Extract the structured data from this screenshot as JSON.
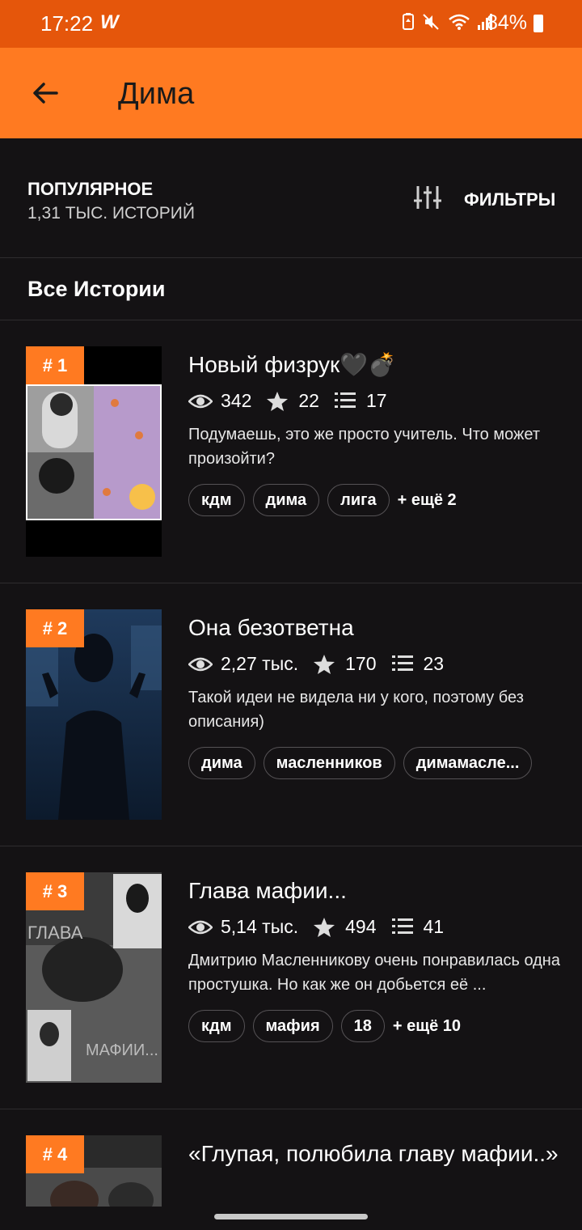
{
  "status_bar": {
    "time": "17:22",
    "app_logo": "W",
    "battery": "84%"
  },
  "app_bar": {
    "title": "Дима"
  },
  "filter_bar": {
    "sort_label": "ПОПУЛЯРНОЕ",
    "count_label": "1,31 ТЫС. ИСТОРИЙ",
    "filters_label": "ФИЛЬТРЫ"
  },
  "section": {
    "title": "Все Истории"
  },
  "stories": [
    {
      "rank": "# 1",
      "title": "Новый физрук🖤💣",
      "views": "342",
      "votes": "22",
      "parts": "17",
      "description": "Подумаешь, это же просто учитель. Что может произойти?",
      "tags": [
        "кдм",
        "дима",
        "лига"
      ],
      "more": "+ ещё 2"
    },
    {
      "rank": "# 2",
      "title": "Она безответна",
      "views": "2,27 тыс.",
      "votes": "170",
      "parts": "23",
      "description": "Такой идеи не видела ни у кого, поэтому без описания)",
      "tags": [
        "дима",
        "масленников",
        "димамасле..."
      ],
      "more": ""
    },
    {
      "rank": "# 3",
      "title": "Глава мафии...",
      "views": "5,14 тыс.",
      "votes": "494",
      "parts": "41",
      "description": "Дмитрию Масленникову очень понравилась одна простушка. Но как же он добьется её ...",
      "tags": [
        "кдм",
        "мафия",
        "18"
      ],
      "more": "+ ещё 10",
      "cover_text_top": "ГЛАВА",
      "cover_text_bottom": "МАФИИ..."
    },
    {
      "rank": "# 4",
      "title": "«Глупая, полюбила главу мафии..»"
    }
  ],
  "icons": {
    "back": "arrow-left-icon",
    "filters": "sliders-icon",
    "views": "eye-icon",
    "votes": "star-icon",
    "parts": "list-icon"
  },
  "colors": {
    "status_bar": "#e5560b",
    "app_bar": "#ff7a21",
    "background": "#141214",
    "rank_badge": "#ff7a21"
  }
}
